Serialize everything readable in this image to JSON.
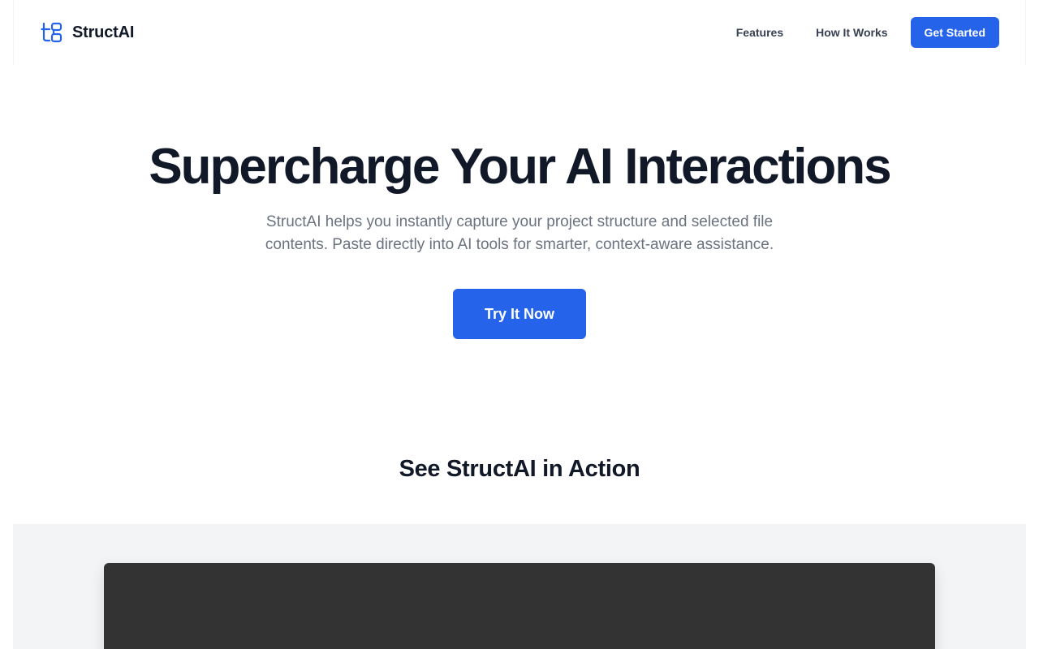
{
  "header": {
    "brand_name": "StructAI",
    "brand_icon": "tree-structure-icon",
    "nav": [
      {
        "label": "Features"
      },
      {
        "label": "How It Works"
      }
    ],
    "cta_label": "Get Started"
  },
  "hero": {
    "title": "Supercharge Your AI Interactions",
    "subtitle": "StructAI helps you instantly capture your project structure and selected file contents. Paste directly into AI tools for smarter, context-aware assistance.",
    "cta_label": "Try It Now"
  },
  "demo": {
    "title": "See StructAI in Action"
  },
  "colors": {
    "accent": "#2563eb",
    "heading": "#111827",
    "muted": "#6b7280",
    "demo_bg": "#f3f4f6",
    "demo_window": "#333333"
  }
}
